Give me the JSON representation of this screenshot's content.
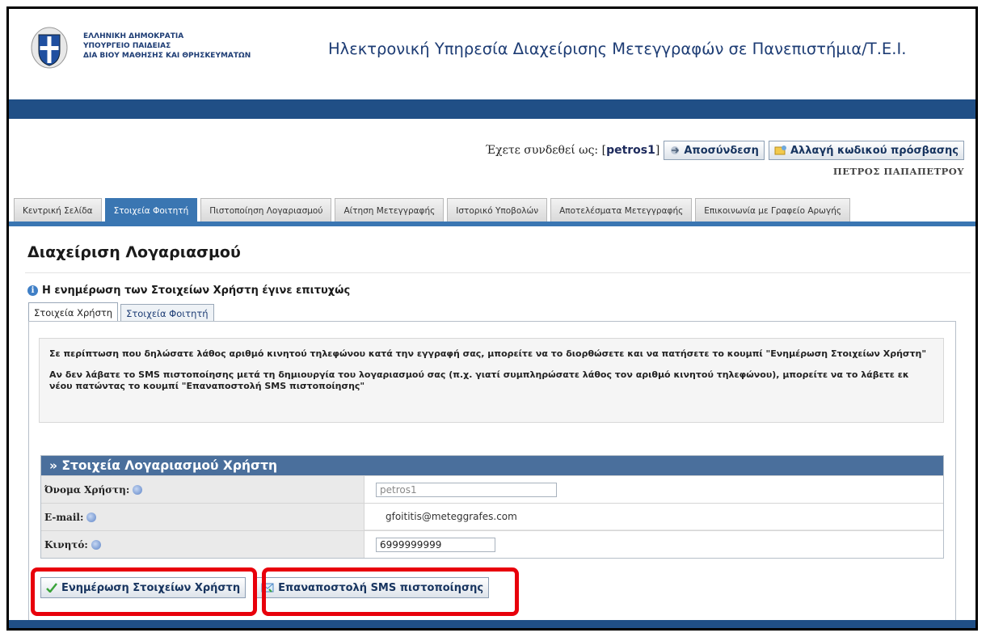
{
  "header": {
    "ministry_line1": "ΕΛΛΗΝΙΚΗ ΔΗΜΟΚΡΑΤΙΑ",
    "ministry_line2": "ΥΠΟΥΡΓΕΙΟ ΠΑΙΔΕΙΑΣ",
    "ministry_line3": "ΔΙΑ ΒΙΟΥ ΜΑΘΗΣΗΣ ΚΑΙ ΘΡΗΣΚΕΥΜΑΤΩΝ",
    "app_title": "Ηλεκτρονική Υπηρεσία Διαχείρισης Μετεγγραφών σε Πανεπιστήμια/Τ.Ε.Ι."
  },
  "user": {
    "logged_prefix": "Έχετε συνδεθεί ως: [",
    "username": "petros1",
    "logged_suffix": "]",
    "logout_label": "Αποσύνδεση",
    "change_password_label": "Αλλαγή κωδικού πρόσβασης",
    "full_name": "ΠΕΤΡΟΣ ΠΑΠΑΠΕΤΡΟΥ"
  },
  "tabs": [
    {
      "label": "Κεντρική Σελίδα"
    },
    {
      "label": "Στοιχεία Φοιτητή"
    },
    {
      "label": "Πιστοποίηση Λογαριασμού"
    },
    {
      "label": "Αίτηση Μετεγγραφής"
    },
    {
      "label": "Ιστορικό Υποβολών"
    },
    {
      "label": "Αποτελέσματα Μετεγγραφής"
    },
    {
      "label": "Επικοινωνία με Γραφείο Αρωγής"
    }
  ],
  "page": {
    "title": "Διαχείριση Λογαριασμού",
    "success_message": "Η ενημέρωση των Στοιχείων Χρήστη έγινε επιτυχώς"
  },
  "subtabs": [
    {
      "label": "Στοιχεία Χρήστη"
    },
    {
      "label": "Στοιχεία Φοιτητή"
    }
  ],
  "notice": {
    "p1": "Σε περίπτωση που δηλώσατε λάθος αριθμό κινητού τηλεφώνου κατά την εγγραφή σας, μπορείτε να το διορθώσετε και να πατήσετε το κουμπί \"Ενημέρωση Στοιχείων Χρήστη\"",
    "p2": "Αν δεν λάβατε το SMS πιστοποίησης μετά τη δημιουργία του λογαριασμού σας (π.χ. γιατί συμπληρώσατε λάθος τον αριθμό κινητού τηλεφώνου), μπορείτε να το λάβετε εκ νέου πατώντας το κουμπί \"Επαναποστολή SMS πιστοποίησης\""
  },
  "account": {
    "heading": "» Στοιχεία Λογαριασμού Χρήστη",
    "username_label": "Όνομα Χρήστη:",
    "username_value": "petros1",
    "email_label": "E-mail:",
    "email_value": "gfoititis@meteggrafes.com",
    "mobile_label": "Κινητό:",
    "mobile_value": "6999999999"
  },
  "actions": {
    "update_label": "Ενημέρωση Στοιχείων Χρήστη",
    "resend_label": "Επαναποστολή SMS πιστοποίησης"
  },
  "colors": {
    "header_bar": "#204f86",
    "active_tab": "#3a76b2",
    "section_header": "#4a6f9c",
    "highlight": "#e8000b"
  }
}
